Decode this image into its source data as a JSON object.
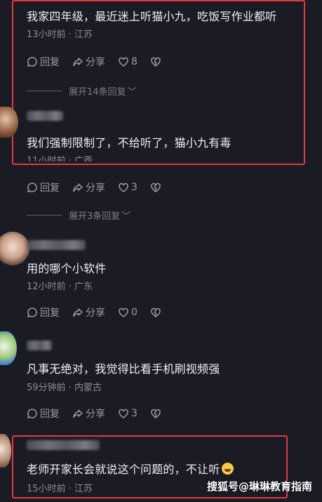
{
  "comments": [
    {
      "text": "我家四年级，最近迷上听猫小九，吃饭写作业都听",
      "meta": "13小时前 · 江苏",
      "reply_label": "回复",
      "share_label": "分享",
      "likes": "8"
    },
    {
      "expand": "展开14条回复",
      "text": "我们强制限制了，不给听了，猫小九有毒",
      "meta": "11小时前 · 广西",
      "reply_label": "回复",
      "share_label": "分享",
      "likes": "3"
    },
    {
      "expand": "展开3条回复",
      "text": "用的哪个小软件",
      "meta": "12小时前 · 广东",
      "reply_label": "回复",
      "share_label": "分享",
      "likes": "0"
    },
    {
      "text": "凡事无绝对，我觉得比看手机刷视频强",
      "meta": "59分钟前 · 内蒙古",
      "reply_label": "回复",
      "share_label": "分享",
      "likes": "3"
    },
    {
      "text": "老师开家长会就说这个问题的，不让听",
      "meta": "15小时前 · 江苏"
    }
  ],
  "watermark": "搜狐号@琳琳教育指南",
  "colors": {
    "background": "#1a1b24",
    "highlight_box": "#e53940"
  }
}
